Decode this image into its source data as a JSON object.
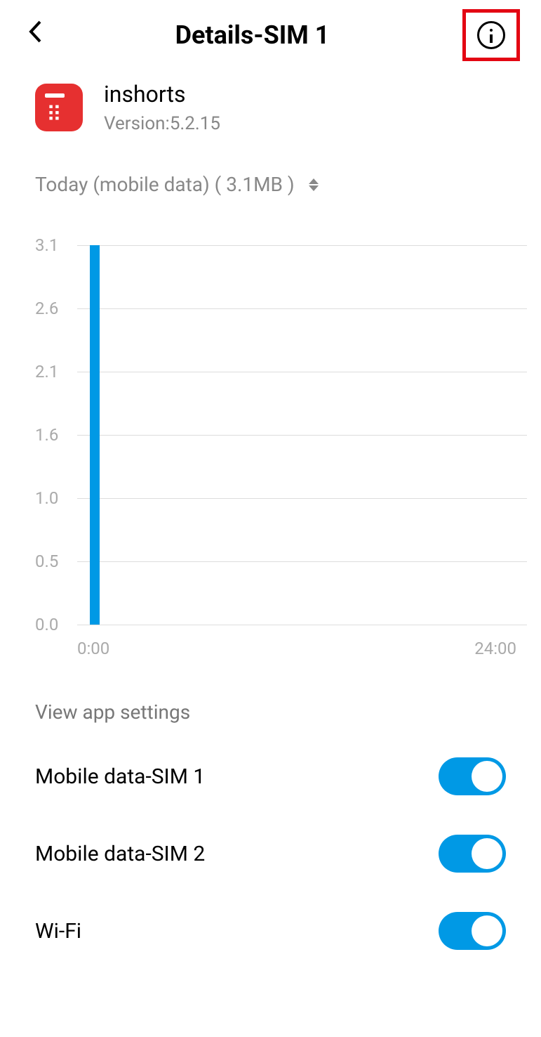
{
  "header": {
    "title": "Details-SIM 1"
  },
  "app": {
    "name": "inshorts",
    "version": "Version:5.2.15"
  },
  "filter": {
    "text": "Today (mobile data) ( 3.1MB )"
  },
  "chart_data": {
    "type": "bar",
    "categories": [
      "0:00",
      "24:00"
    ],
    "values": [
      3.1
    ],
    "title": "",
    "xlabel": "",
    "ylabel": "",
    "ylim": [
      0,
      3.1
    ],
    "yticks": [
      "0.0",
      "0.5",
      "1.0",
      "1.6",
      "2.1",
      "2.6",
      "3.1"
    ],
    "xticks": [
      "0:00",
      "24:00"
    ]
  },
  "section": {
    "title": "View app settings"
  },
  "settings": [
    {
      "label": "Mobile data-SIM 1",
      "enabled": true
    },
    {
      "label": "Mobile data-SIM 2",
      "enabled": true
    },
    {
      "label": "Wi-Fi",
      "enabled": true
    }
  ]
}
